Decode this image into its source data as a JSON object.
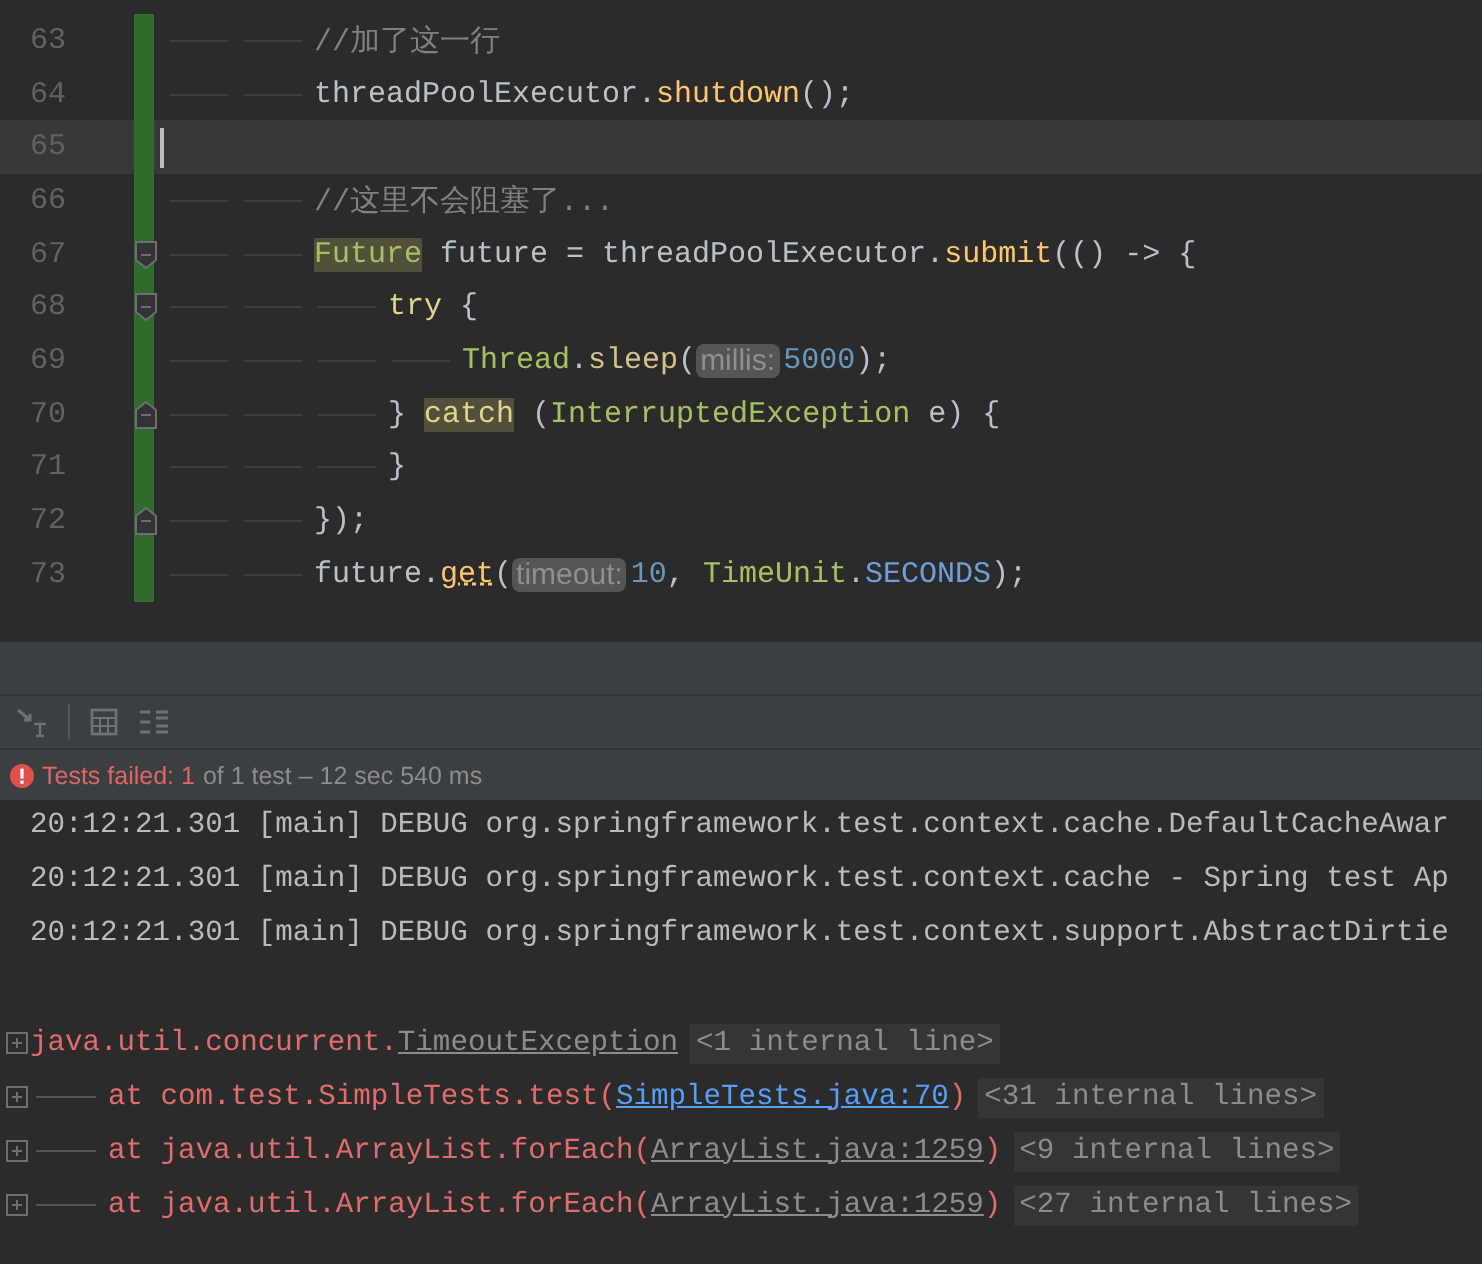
{
  "editor": {
    "lines": [
      {
        "number": "63",
        "changed": true,
        "current": false,
        "fold_open": false,
        "fold_close": false,
        "tokens": [
          {
            "kind": "tab"
          },
          {
            "kind": "tab"
          },
          {
            "kind": "comment",
            "text": "//加了这一行"
          }
        ]
      },
      {
        "number": "64",
        "changed": true,
        "current": false,
        "fold_open": false,
        "fold_close": false,
        "tokens": [
          {
            "kind": "tab"
          },
          {
            "kind": "tab"
          },
          {
            "kind": "plain",
            "text": "threadPoolExecutor."
          },
          {
            "kind": "method",
            "text": "shutdown"
          },
          {
            "kind": "plain",
            "text": "();"
          }
        ]
      },
      {
        "number": "65",
        "changed": true,
        "current": true,
        "fold_open": false,
        "fold_close": false,
        "tokens": [
          {
            "kind": "caret"
          }
        ]
      },
      {
        "number": "66",
        "changed": true,
        "current": false,
        "fold_open": false,
        "fold_close": false,
        "tokens": [
          {
            "kind": "tab"
          },
          {
            "kind": "tab"
          },
          {
            "kind": "comment",
            "text": "//这里不会阻塞了..."
          }
        ]
      },
      {
        "number": "67",
        "changed": true,
        "current": false,
        "fold_open": true,
        "fold_close": false,
        "tokens": [
          {
            "kind": "tab"
          },
          {
            "kind": "tab"
          },
          {
            "kind": "class-marked",
            "text": "Future"
          },
          {
            "kind": "plain",
            "text": " future = threadPoolExecutor."
          },
          {
            "kind": "method",
            "text": "submit"
          },
          {
            "kind": "plain",
            "text": "(() -> {"
          }
        ]
      },
      {
        "number": "68",
        "changed": true,
        "current": false,
        "fold_open": true,
        "fold_close": false,
        "tokens": [
          {
            "kind": "tab"
          },
          {
            "kind": "tab"
          },
          {
            "kind": "tab"
          },
          {
            "kind": "keyword",
            "text": "try"
          },
          {
            "kind": "plain",
            "text": " {"
          }
        ]
      },
      {
        "number": "69",
        "changed": true,
        "current": false,
        "fold_open": false,
        "fold_close": false,
        "tokens": [
          {
            "kind": "tab"
          },
          {
            "kind": "tab"
          },
          {
            "kind": "tab"
          },
          {
            "kind": "tab"
          },
          {
            "kind": "class",
            "text": "Thread"
          },
          {
            "kind": "plain",
            "text": "."
          },
          {
            "kind": "static",
            "text": "sleep"
          },
          {
            "kind": "plain",
            "text": "("
          },
          {
            "kind": "hint",
            "text": "millis:"
          },
          {
            "kind": "number",
            "text": "5000"
          },
          {
            "kind": "plain",
            "text": ");"
          }
        ]
      },
      {
        "number": "70",
        "changed": true,
        "current": false,
        "fold_open": false,
        "fold_close": true,
        "tokens": [
          {
            "kind": "tab"
          },
          {
            "kind": "tab"
          },
          {
            "kind": "tab"
          },
          {
            "kind": "plain",
            "text": "} "
          },
          {
            "kind": "keyword-marked",
            "text": "catch"
          },
          {
            "kind": "plain",
            "text": " ("
          },
          {
            "kind": "class",
            "text": "InterruptedException"
          },
          {
            "kind": "plain",
            "text": " e) {"
          }
        ]
      },
      {
        "number": "71",
        "changed": true,
        "current": false,
        "fold_open": false,
        "fold_close": false,
        "tokens": [
          {
            "kind": "tab"
          },
          {
            "kind": "tab"
          },
          {
            "kind": "tab"
          },
          {
            "kind": "plain",
            "text": "}"
          }
        ]
      },
      {
        "number": "72",
        "changed": true,
        "current": false,
        "fold_open": false,
        "fold_close": true,
        "tokens": [
          {
            "kind": "tab"
          },
          {
            "kind": "tab"
          },
          {
            "kind": "plain",
            "text": "});"
          }
        ]
      },
      {
        "number": "73",
        "changed": true,
        "current": false,
        "fold_open": false,
        "fold_close": false,
        "tokens": [
          {
            "kind": "tab"
          },
          {
            "kind": "tab"
          },
          {
            "kind": "plain",
            "text": "future."
          },
          {
            "kind": "method-warn",
            "text": "get"
          },
          {
            "kind": "plain",
            "text": "("
          },
          {
            "kind": "hint",
            "text": "timeout:"
          },
          {
            "kind": "number",
            "text": "10"
          },
          {
            "kind": "plain",
            "text": ", "
          },
          {
            "kind": "class",
            "text": "TimeUnit"
          },
          {
            "kind": "plain",
            "text": "."
          },
          {
            "kind": "constant",
            "text": "SECONDS"
          },
          {
            "kind": "plain",
            "text": ");"
          }
        ]
      }
    ]
  },
  "test_status": {
    "failed": true,
    "failed_label": "Tests failed: 1",
    "summary": "of 1 test – 12 sec 540 ms"
  },
  "console": {
    "log_lines": [
      "20:12:21.301 [main] DEBUG org.springframework.test.context.cache.DefaultCacheAwar",
      "20:12:21.301 [main] DEBUG org.springframework.test.context.cache - Spring test Ap",
      "20:12:21.301 [main] DEBUG org.springframework.test.context.support.AbstractDirtie"
    ],
    "trace": [
      {
        "kind": "exception",
        "parts": [
          {
            "kind": "text",
            "text": "java.util.concurrent."
          },
          {
            "kind": "source",
            "text": "TimeoutException"
          },
          {
            "kind": "folded",
            "text": "<1 internal line>"
          }
        ]
      },
      {
        "kind": "frame",
        "parts": [
          {
            "kind": "text",
            "text": "at com.test.SimpleTests.test("
          },
          {
            "kind": "link",
            "text": "SimpleTests.java:70"
          },
          {
            "kind": "text",
            "text": ")"
          },
          {
            "kind": "folded",
            "text": "<31 internal lines>"
          }
        ]
      },
      {
        "kind": "frame",
        "parts": [
          {
            "kind": "text",
            "text": "at java.util.ArrayList.forEach("
          },
          {
            "kind": "source",
            "text": "ArrayList.java:1259"
          },
          {
            "kind": "text",
            "text": ")"
          },
          {
            "kind": "folded",
            "text": "<9 internal lines>"
          }
        ]
      },
      {
        "kind": "frame",
        "parts": [
          {
            "kind": "text",
            "text": "at java.util.ArrayList.forEach("
          },
          {
            "kind": "source",
            "text": "ArrayList.java:1259"
          },
          {
            "kind": "text",
            "text": ")"
          },
          {
            "kind": "folded",
            "text": "<27 internal lines>"
          }
        ]
      }
    ]
  }
}
